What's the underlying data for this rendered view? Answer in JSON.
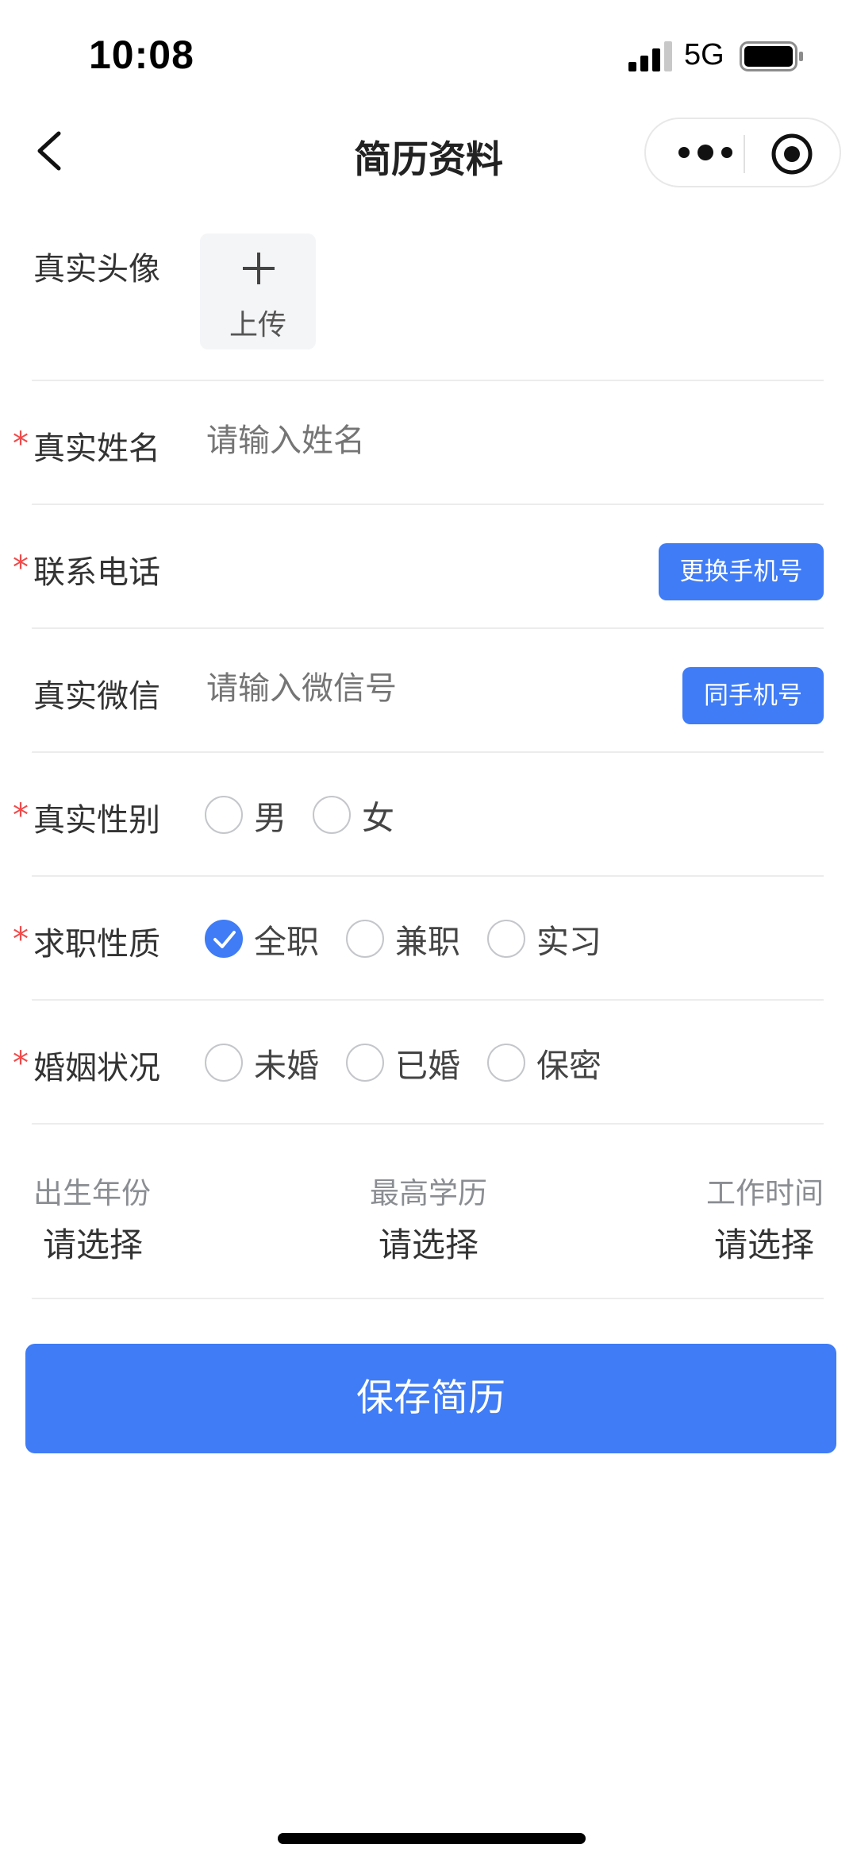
{
  "status_bar": {
    "time": "10:08",
    "network": "5G"
  },
  "nav": {
    "title": "简历资料"
  },
  "form": {
    "avatar": {
      "label": "真实头像",
      "upload_label": "上传"
    },
    "name": {
      "label": "真实姓名",
      "placeholder": "请输入姓名"
    },
    "phone": {
      "label": "联系电话",
      "value": "",
      "change_button": "更换手机号"
    },
    "wechat": {
      "label": "真实微信",
      "placeholder": "请输入微信号",
      "same_button": "同手机号"
    },
    "gender": {
      "label": "真实性别",
      "options": [
        "男",
        "女"
      ],
      "selected": null
    },
    "job_type": {
      "label": "求职性质",
      "options": [
        "全职",
        "兼职",
        "实习"
      ],
      "selected": "全职"
    },
    "marital": {
      "label": "婚姻状况",
      "options": [
        "未婚",
        "已婚",
        "保密"
      ],
      "selected": null
    },
    "pickers": [
      {
        "label": "出生年份",
        "value": "请选择"
      },
      {
        "label": "最高学历",
        "value": "请选择"
      },
      {
        "label": "工作时间",
        "value": "请选择"
      }
    ],
    "required_mark": "*"
  },
  "save_button": "保存简历",
  "colors": {
    "primary": "#3f7cf6",
    "required": "#f04a4a",
    "placeholder": "#c2c4c8"
  }
}
